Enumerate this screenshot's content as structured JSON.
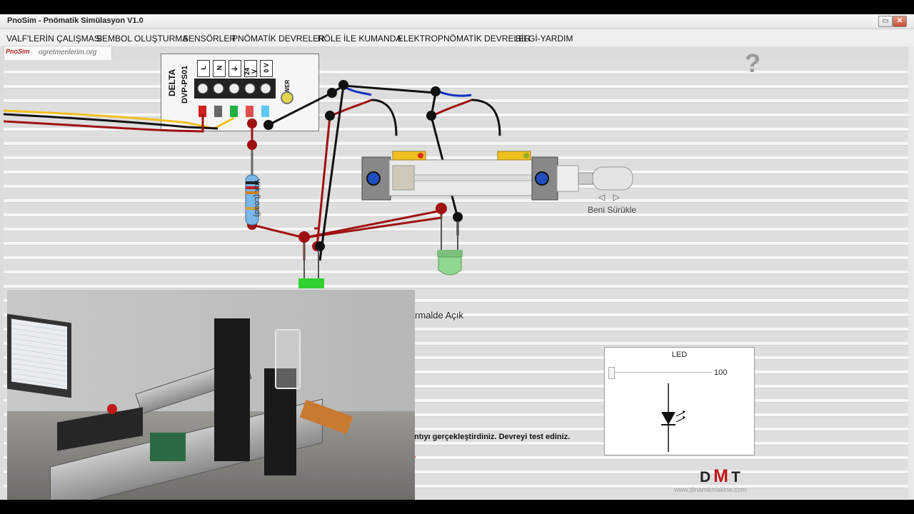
{
  "window": {
    "title": "PnoSim - Pnömatik Simülasyon V1.0",
    "buttons": {
      "minimize": "▭",
      "close": "✕"
    }
  },
  "menu": {
    "items": [
      {
        "label": "VALF'LERİN ÇALIŞMASI"
      },
      {
        "label": "SEMBOL OLUŞTURMA"
      },
      {
        "label": "SENSÖRLER"
      },
      {
        "label": "PNÖMATİK DEVRELER"
      },
      {
        "label": "RÖLE İLE KUMANDA"
      },
      {
        "label": "ELEKTROPNÖMATİK DEVRELER"
      },
      {
        "label": "BİLGİ-YARDIM"
      }
    ]
  },
  "logo": {
    "mark": "PnoSim",
    "url": "ogretmenlerim.org"
  },
  "help": {
    "label": "?"
  },
  "power_supply": {
    "brand": "DELTA",
    "model": "DVP-PS01",
    "terminals": [
      "L",
      "N",
      "⏚",
      "24 V",
      "0 V"
    ],
    "power_label": "POWER"
  },
  "load": {
    "label": "Yük (Load)"
  },
  "cylinder": {
    "drag_label": "Beni Sürükle",
    "drag_arrows": "◁ ▷"
  },
  "circuit": {
    "normally_open_text": "rmalde Açık",
    "task_text": "ntıyı gerçekleştirdiniz. Devreyi test ediniz."
  },
  "led_panel": {
    "title": "LED",
    "value": "100",
    "level": 0
  },
  "footer": {
    "brand_d": "D",
    "brand_m": "M",
    "brand_t": "T",
    "url": "www.dinamikmakine.com"
  },
  "colors": {
    "wire_red": "#a01010",
    "wire_black": "#111111",
    "wire_blue": "#1030c0",
    "led_green": "#30d030",
    "sensor_yellow": "#f0c020"
  }
}
